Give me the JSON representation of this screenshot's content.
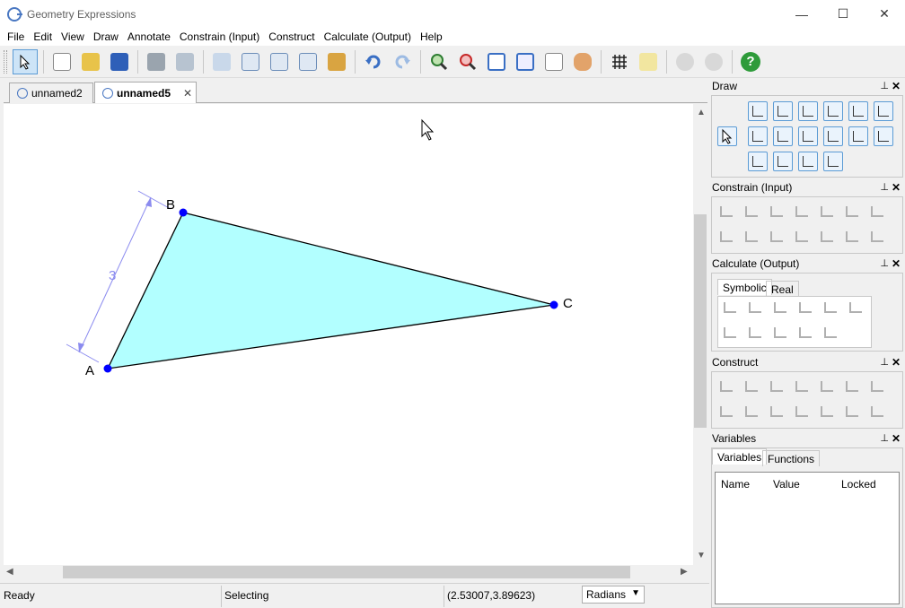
{
  "window": {
    "title": "Geometry Expressions",
    "minimize": "—",
    "maximize": "☐",
    "close": "✕"
  },
  "menu": [
    "File",
    "Edit",
    "View",
    "Draw",
    "Annotate",
    "Constrain (Input)",
    "Construct",
    "Calculate (Output)",
    "Help"
  ],
  "tabs": [
    {
      "label": "unnamed2"
    },
    {
      "label": "unnamed5",
      "close": "✕"
    }
  ],
  "drawing": {
    "points": [
      {
        "name": "A"
      },
      {
        "name": "B"
      },
      {
        "name": "C"
      }
    ],
    "dimension_label": "3",
    "fill_color": "#b2ffff",
    "point_color": "#0000ff",
    "dimension_color": "#8b8bef"
  },
  "status": {
    "ready": "Ready",
    "mode": "Selecting",
    "coords": "(2.53007,3.89623)",
    "angle_unit": "Radians"
  },
  "panels": {
    "draw": {
      "title": "Draw"
    },
    "constrain": {
      "title": "Constrain (Input)"
    },
    "calculate": {
      "title": "Calculate (Output)",
      "tabs": [
        "Symbolic",
        "Real"
      ]
    },
    "construct": {
      "title": "Construct"
    },
    "variables": {
      "title": "Variables",
      "tabs": [
        "Variables",
        "Functions"
      ],
      "columns": [
        "Name",
        "Value",
        "Locked"
      ]
    }
  },
  "icons": {
    "pin": "📌",
    "panel_close": "✕",
    "help": "?"
  }
}
